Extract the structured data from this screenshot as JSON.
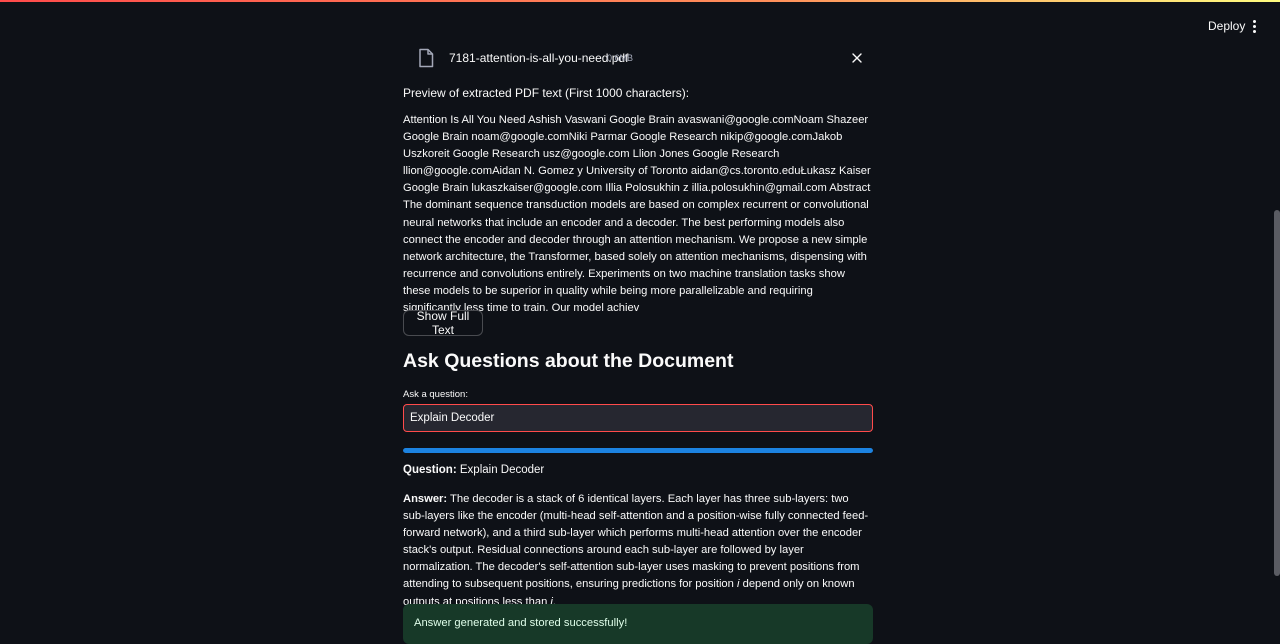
{
  "header": {
    "deploy_label": "Deploy",
    "menu_icon": "kebab-menu-icon"
  },
  "file": {
    "icon": "file-icon",
    "name": "7181-attention-is-all-you-need.pdf",
    "size": "0.6MB",
    "close_icon": "close-icon"
  },
  "preview": {
    "label": "Preview of extracted PDF text (First 1000 characters):",
    "text": "Attention Is All You Need Ashish Vaswani  Google Brain avaswani@google.comNoam Shazeer  Google Brain noam@google.comNiki Parmar  Google Research nikip@google.comJakob Uszkoreit  Google Research usz@google.com Llion Jones  Google Research llion@google.comAidan N. Gomez  y University of Toronto aidan@cs.toronto.eduŁukasz Kaiser  Google Brain lukaszkaiser@google.com Illia Polosukhin  z illia.polosukhin@gmail.com Abstract The dominant sequence transduction models are based on complex recurrent or convolutional neural networks that include an encoder and a decoder. The best performing models also connect the encoder and decoder through an attention mechanism. We propose a new simple network architecture, the Transformer, based solely on attention mechanisms, dispensing with recurrence and convolutions entirely. Experiments on two machine translation tasks show these models to be superior in quality while being more parallelizable and requiring significantly less time to train. Our model achiev"
  },
  "show_full_text_label": "Show Full Text",
  "qa": {
    "section_title": "Ask Questions about the Document",
    "input_label": "Ask a question:",
    "input_value": "Explain Decoder",
    "progress": 1.0,
    "question_label": "Question:",
    "question_text": "Explain Decoder",
    "answer_label": "Answer:",
    "answer_text_1": "The decoder is a stack of 6 identical layers. Each layer has three sub-layers: two sub-layers like the encoder (multi-head self-attention and a position-wise fully connected feed-forward network), and a third sub-layer which performs multi-head attention over the encoder stack's output. Residual connections around each sub-layer are followed by layer normalization. The decoder's self-attention sub-layer uses masking to prevent positions from attending to subsequent positions, ensuring predictions for position ",
    "answer_var_1": "i",
    "answer_text_2": " depend only on known outputs at positions less than ",
    "answer_var_2": "i",
    "answer_text_3": ".",
    "success_message": "Answer generated and stored successfully!"
  },
  "colors": {
    "background": "#0e1117",
    "accent_red": "#ff4b4b",
    "progress_blue": "#1c83e1",
    "success_bg": "#173928"
  }
}
